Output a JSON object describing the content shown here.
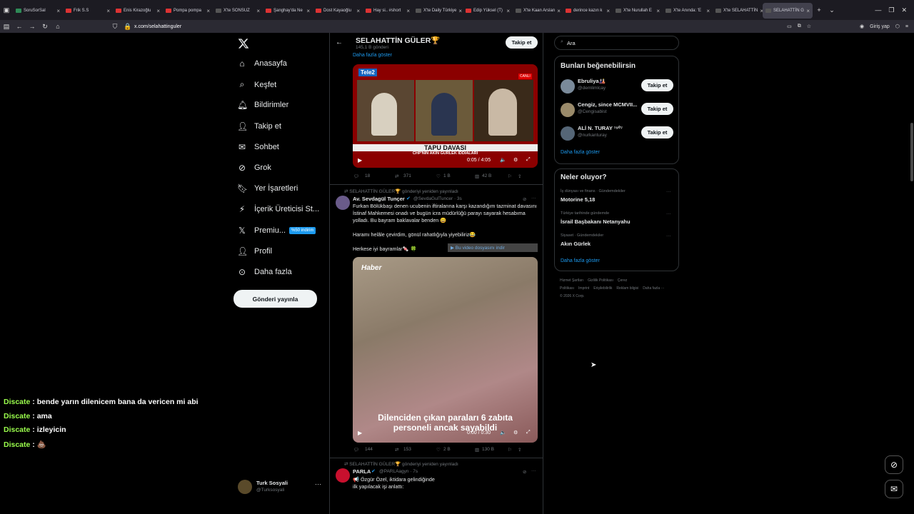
{
  "browser": {
    "tabs": [
      {
        "label": "SoruSorSal",
        "color": "#2e8b57"
      },
      {
        "label": "Frik S.S",
        "color": "#d33"
      },
      {
        "label": "Enis Kirazoğlu",
        "color": "#d33"
      },
      {
        "label": "Pompa pompa",
        "color": "#d33"
      },
      {
        "label": "X'te SONSUZ",
        "color": "#555"
      },
      {
        "label": "Şanghay'da Ne",
        "color": "#d33"
      },
      {
        "label": "Dost Kayaoğlu",
        "color": "#d33"
      },
      {
        "label": "Hay si.. #short",
        "color": "#d33"
      },
      {
        "label": "X'te Daily Türkiye",
        "color": "#555"
      },
      {
        "label": "Edip Yüksel (T)",
        "color": "#d33"
      },
      {
        "label": "X'te Kaan Arslan",
        "color": "#555"
      },
      {
        "label": "derince kazın k",
        "color": "#d33"
      },
      {
        "label": "X'te Nurullah E",
        "color": "#555"
      },
      {
        "label": "X'te Anında: 'E",
        "color": "#555"
      },
      {
        "label": "X'te SELAHATTİN",
        "color": "#555"
      },
      {
        "label": "SELAHATTİN G",
        "color": "#555",
        "active": true
      }
    ],
    "url": "x.com/selahattinguler",
    "signin_label": "Giriş yap"
  },
  "nav": {
    "items": [
      "Anasayfa",
      "Keşfet",
      "Bildirimler",
      "Takip et",
      "Sohbet",
      "Grok",
      "Yer İşaretleri",
      "İçerik Üreticisi St...",
      "Premiu...",
      "Profil",
      "Daha fazla"
    ],
    "premium_badge": "%50 indirim",
    "post_button": "Gönderi yayınla",
    "account_name": "Turk Sosyali",
    "account_handle": "@Turksosyali"
  },
  "profile": {
    "name": "SELAHATTİN GÜLER🏆",
    "posts": "145,1 B gönderi",
    "follow_label": "Takip et",
    "show_more": "Daha fazla göster"
  },
  "tweet1": {
    "video_title": "TAPU DAVASI",
    "video_subtitle": "CHP'NİN AKIN GÜRLEK İDDİALARI",
    "live_badge": "CANLI",
    "channel": "Tele2",
    "time": "0:05 / 4:05",
    "stats": {
      "replies": "18",
      "reposts": "371",
      "likes": "1 B",
      "views": "42 B"
    }
  },
  "tweet2": {
    "repost_note": "SELAHATTİN GÜLER🏆 gönderiyi yeniden yayınladı",
    "author": "Av. Sevdagül Tunçer",
    "handle": "@SevdaGulTuncer · 3s",
    "text1": "Furkan Bölükbaşı denen ucubenin iftiralarına karşı kazandığım tazminat davasını İstinaf Mahkemesi onadı ve bugün icra müdürlüğü parayı sayarak hesabıma yolladı. Bu bayram baklavalar benden 😄",
    "text2": "Haramı helâle çevirdim, gönül rahatlığıyla yiyebiliriz😂",
    "text3": "Herkese iyi bayramlar🍬 🍀",
    "download_label": "▶ Bu video dosyasını indir",
    "video_caption": "Dilenciden çıkan paraları 6 zabıta personeli ancak sayabildi",
    "video_logo": "Haber",
    "time": "0:00 / 0:30",
    "stats": {
      "replies": "144",
      "reposts": "153",
      "likes": "2 B",
      "views": "130 B"
    }
  },
  "tweet3": {
    "repost_note": "SELAHATTİN GÜLER🏆 gönderiyi yeniden yayınladı",
    "author": "PARLA",
    "handle": "@PARLAagyn · 7s",
    "text1": "📢 Özgür Özel, iktidara gelindiğinde",
    "text2": "ilk yapılacak işi anlattı:"
  },
  "search": {
    "placeholder": "Ara"
  },
  "suggestions": {
    "title": "Bunları beğenebilirsin",
    "users": [
      {
        "name": "Ebruliya🎎",
        "handle": "@demlimlcay"
      },
      {
        "name": "Cengiz, since MCMVII...",
        "handle": "@Cengisabist"
      },
      {
        "name": "ALİ N. TURAY ¹⁹⁰⁷",
        "handle": "@nurkanturay"
      }
    ],
    "follow_label": "Takip et",
    "show_more": "Daha fazla göster"
  },
  "trends": {
    "title": "Neler oluyor?",
    "items": [
      {
        "context": "İş dünyası ve finans · Gündemdekiler",
        "topic": "Motorine 5,18"
      },
      {
        "context": "Türkiye tarihinde gündemde",
        "topic": "İsrail Başbakanı Netanyahu"
      },
      {
        "context": "Siyaset · Gündemdekiler",
        "topic": "Akın Gürlek"
      }
    ],
    "show_more": "Daha fazla göster"
  },
  "footer": {
    "links": [
      "Hizmet Şartları",
      "Gizlilik Politikası",
      "Çerez Politikası",
      "Imprint",
      "Erişilebilirlik",
      "Reklam bilgisi",
      "Daha fazla ···"
    ],
    "copyright": "© 2026 X Corp."
  },
  "chat": [
    {
      "user": "Discate",
      "text": ": bende yarın dilenicem bana da vericen mi abi"
    },
    {
      "user": "Discate",
      "text": ": ama"
    },
    {
      "user": "Discate",
      "text": ": izleyicin"
    },
    {
      "user": "Discate",
      "text": ": 💩"
    }
  ]
}
